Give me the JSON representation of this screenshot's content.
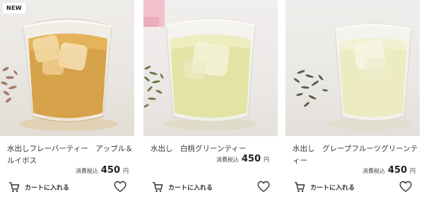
{
  "products": [
    {
      "badge": "NEW",
      "title": "水出しフレーバーティー　アップル＆ルイボス",
      "price_tax_label": "消費税込",
      "price": "450",
      "currency": "円",
      "cart_label": "カートに入れる",
      "tea_color": "#d6a24a",
      "leaf_color": "#9b6a55"
    },
    {
      "title": "水出し　白桃グリーンティー",
      "price_tax_label": "消費税込",
      "price": "450",
      "currency": "円",
      "cart_label": "カートに入れる",
      "tea_color": "#e3e3a6",
      "leaf_color": "#5f6b3b"
    },
    {
      "title": "水出し　グレープフルーツグリーンティー",
      "price_tax_label": "消費税込",
      "price": "450",
      "currency": "円",
      "cart_label": "カートに入れる",
      "tea_color": "#ecebc1",
      "leaf_color": "#4a4f33"
    }
  ],
  "icons": {
    "cart": "cart-icon",
    "favorite": "heart-icon"
  }
}
